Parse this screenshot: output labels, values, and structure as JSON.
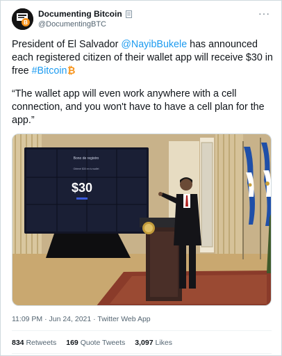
{
  "user": {
    "display_name": "Documenting Bitcoin",
    "handle": "@DocumentingBTC",
    "avatar_icon": "documenting-bitcoin-logo",
    "badge_icon": "document-icon"
  },
  "more_icon": "···",
  "tweet": {
    "para1_a": "President of El Salvador ",
    "mention": "@NayibBukele",
    "para1_b": " has announced each registered citizen of their wallet app will receive $30 in free ",
    "hashtag": "#Bitcoin",
    "emoji": "bitcoin-icon",
    "para2": "“The wallet app will even work anywhere with a cell connection, and you won't have to have a cell plan for the app.”"
  },
  "media": {
    "screen_heading": "Bono de registro",
    "screen_sub": "Obtené $30 en tu wallet",
    "screen_amount": "$30",
    "alt": "photo"
  },
  "meta": {
    "time": "11:09 PM · Jun 24, 2021",
    "source": "Twitter Web App"
  },
  "stats": {
    "retweets_count": "834",
    "retweets_label": "Retweets",
    "quotes_count": "169",
    "quotes_label": "Quote Tweets",
    "likes_count": "3,097",
    "likes_label": "Likes"
  },
  "colors": {
    "link": "#1d9bf0",
    "secondary_text": "#536471",
    "bitcoin": "#f7931a"
  }
}
